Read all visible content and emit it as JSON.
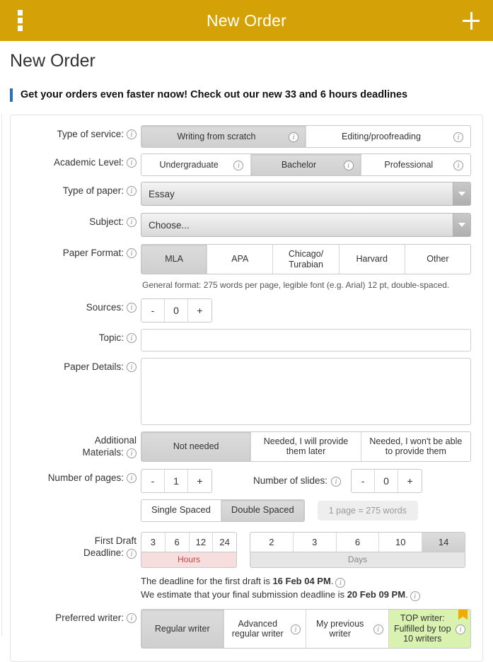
{
  "appbar": {
    "title": "New Order",
    "menu_icon": "overflow-menu-icon",
    "add_icon": "plus-icon"
  },
  "page": {
    "title": "New Order",
    "banner": "Get your orders even faster nɑow! Check out our new 33 and 6 hours deadlines"
  },
  "colors": {
    "appbar": "#d4a206",
    "banner_accent": "#2d6fb5",
    "hours_bar_bg": "#f7dede",
    "hours_bar_text": "#cc4444",
    "days_bar_bg": "#e6e6e6",
    "top_writer_bg": "#d9f2b0",
    "flag": "#f0ab00"
  },
  "form": {
    "type_of_service": {
      "label": "Type of service:",
      "options": [
        {
          "label": "Writing from scratch",
          "selected": true,
          "info": true
        },
        {
          "label": "Editing/proofreading",
          "selected": false,
          "info": true
        }
      ]
    },
    "academic_level": {
      "label": "Academic Level:",
      "options": [
        {
          "label": "Undergraduate",
          "selected": false,
          "info": true
        },
        {
          "label": "Bachelor",
          "selected": true,
          "info": true
        },
        {
          "label": "Professional",
          "selected": false,
          "info": true
        }
      ]
    },
    "type_of_paper": {
      "label": "Type of paper:",
      "value": "Essay"
    },
    "subject": {
      "label": "Subject:",
      "value": "Choose..."
    },
    "paper_format": {
      "label": "Paper Format:",
      "options": [
        {
          "label": "MLA",
          "selected": true
        },
        {
          "label": "APA",
          "selected": false
        },
        {
          "label": "Chicago/\nTurabian",
          "selected": false
        },
        {
          "label": "Harvard",
          "selected": false
        },
        {
          "label": "Other",
          "selected": false
        }
      ],
      "hint": "General format: 275 words per page, legible font (e.g. Arial) 12 pt, double-spaced."
    },
    "sources": {
      "label": "Sources:",
      "minus": "-",
      "value": "0",
      "plus": "+"
    },
    "topic": {
      "label": "Topic:",
      "value": ""
    },
    "paper_details": {
      "label": "Paper Details:",
      "value": ""
    },
    "additional_materials": {
      "label_line1": "Additional",
      "label_line2": "Materials:",
      "options": [
        {
          "label": "Not needed",
          "selected": true
        },
        {
          "label": "Needed, I will provide\nthem later",
          "selected": false
        },
        {
          "label": "Needed, I won't be able\nto provide them",
          "selected": false
        }
      ]
    },
    "number_of_pages": {
      "label": "Number of pages:",
      "minus": "-",
      "value": "1",
      "plus": "+"
    },
    "number_of_slides": {
      "label": "Number of slides:",
      "minus": "-",
      "value": "0",
      "plus": "+"
    },
    "spacing": {
      "options": [
        {
          "label": "Single Spaced",
          "selected": false
        },
        {
          "label": "Double Spaced",
          "selected": true
        }
      ],
      "pill": "1 page = 275 words"
    },
    "first_draft_deadline": {
      "label_line1": "First Draft",
      "label_line2": "Deadline:",
      "hours": {
        "cells": [
          {
            "label": "3",
            "selected": false
          },
          {
            "label": "6",
            "selected": false
          },
          {
            "label": "12",
            "selected": false
          },
          {
            "label": "24",
            "selected": false
          }
        ],
        "bar": "Hours"
      },
      "days": {
        "cells": [
          {
            "label": "2",
            "selected": false
          },
          {
            "label": "3",
            "selected": false
          },
          {
            "label": "6",
            "selected": false
          },
          {
            "label": "10",
            "selected": false
          },
          {
            "label": "14",
            "selected": true
          }
        ],
        "bar": "Days"
      },
      "note_line1_pre": "The deadline for the first draft is ",
      "note_line1_value": "16 Feb 04 PM",
      "note_line1_post": ".",
      "note_line2_pre": "We estimate that your final submission deadline is ",
      "note_line2_value": "20 Feb 09 PM",
      "note_line2_post": "."
    },
    "preferred_writer": {
      "label": "Preferred writer:",
      "options": [
        {
          "label": "Regular writer",
          "selected": true,
          "info": false,
          "green": false
        },
        {
          "label": "Advanced\nregular writer",
          "selected": false,
          "info": true,
          "green": false
        },
        {
          "label": "My previous\nwriter",
          "selected": false,
          "info": true,
          "green": false
        },
        {
          "label": "TOP writer:\nFulfilled by top\n10 writers",
          "selected": false,
          "info": true,
          "green": true
        }
      ]
    }
  }
}
